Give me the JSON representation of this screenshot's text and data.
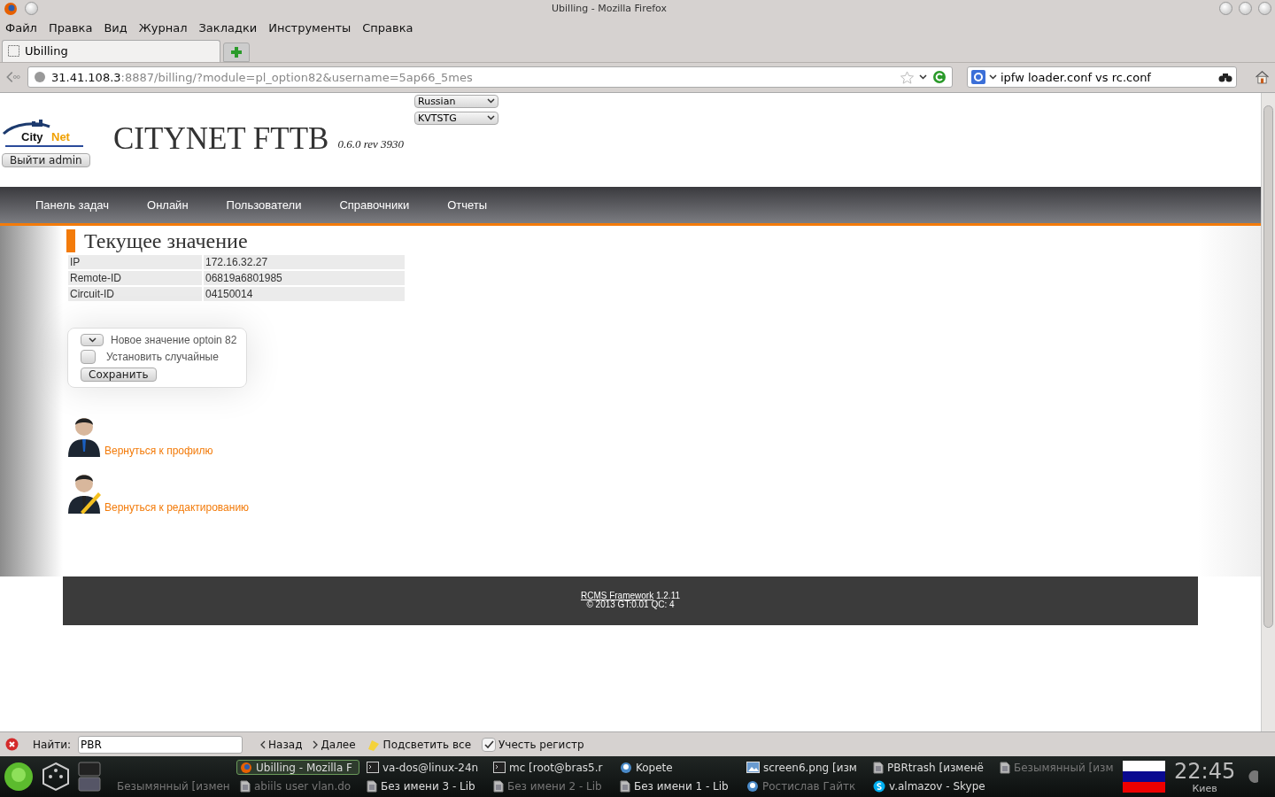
{
  "window": {
    "title": "Ubilling - Mozilla Firefox"
  },
  "menu": [
    "Файл",
    "Правка",
    "Вид",
    "Журнал",
    "Закладки",
    "Инструменты",
    "Справка"
  ],
  "tabs": [
    {
      "label": "Ubilling",
      "selected": true
    }
  ],
  "address": {
    "host": "31.41.108.3",
    "rest": ":8887/billing/?module=pl_option82&username=5ap66_5mes"
  },
  "search": {
    "value": "ipfw loader.conf vs rc.conf"
  },
  "logo": {
    "word_1": "City",
    "word_2": "Net"
  },
  "header": {
    "language": "Russian",
    "server": "KVTSTG",
    "logout": "Выйти admin",
    "title": "CITYNET FTTB",
    "version": "0.6.0 rev 3930"
  },
  "nav": [
    "Панель задач",
    "Онлайн",
    "Пользователи",
    "Справочники",
    "Отчеты"
  ],
  "section": {
    "title": "Текущее значение",
    "rows": [
      {
        "name": "IP",
        "value": "172.16.32.27"
      },
      {
        "name": "Remote-ID",
        "value": "06819a6801985"
      },
      {
        "name": "Circuit-ID",
        "value": "04150014"
      }
    ]
  },
  "form": {
    "select_label": "Новое значение optoin 82",
    "random_label": "Установить случайные",
    "random_checked": false,
    "save": "Сохранить"
  },
  "links": [
    {
      "kind": "profile",
      "label": "Вернуться к профилю"
    },
    {
      "kind": "edit",
      "label": "Вернуться к редактированию"
    }
  ],
  "footer": {
    "link": "RCMS Framework",
    "version": "1.2.11",
    "stats": "© 2013 GT:0.01 QC: 4"
  },
  "find_bar": {
    "label": "Найти:",
    "value": "PBR",
    "prev": "Назад",
    "next": "Далее",
    "highlight": "Подсветить все",
    "match_case": "Учесть регистр",
    "match_case_checked": true
  },
  "taskbar": {
    "columns": [
      {
        "bottom": {
          "label": "Безымянный [измен",
          "kind": "doc",
          "minimized": true
        }
      },
      {
        "top": {
          "label": "Ubilling - Mozilla F",
          "kind": "browser",
          "minimized": false,
          "selected": true
        },
        "bottom": {
          "label": "abiils user vlan.do",
          "kind": "doc",
          "minimized": true
        }
      },
      {
        "top": {
          "label": "va-dos@linux-24n",
          "kind": "terminal",
          "minimized": false
        },
        "bottom": {
          "label": "Без имени 3 - Lib",
          "kind": "doc",
          "minimized": false
        }
      },
      {
        "top": {
          "label": "mc [root@bras5.r",
          "kind": "terminal",
          "minimized": false
        },
        "bottom": {
          "label": "Без имени 2 - Lib",
          "kind": "doc",
          "minimized": true
        }
      },
      {
        "top": {
          "label": "Kopete",
          "kind": "chat",
          "minimized": false
        },
        "bottom": {
          "label": "Без имени 1 - Lib",
          "kind": "doc",
          "minimized": false
        }
      },
      {
        "top": {
          "label": "screen6.png [изм",
          "kind": "image",
          "minimized": false
        },
        "bottom": {
          "label": "Ростислав Гайтк",
          "kind": "chat",
          "minimized": true
        }
      },
      {
        "top": {
          "label": "PBRtrash [изменё",
          "kind": "doc",
          "minimized": false
        },
        "bottom": {
          "label": "v.almazov - Skype",
          "kind": "skype",
          "minimized": false
        }
      },
      {
        "top": {
          "label": "Безымянный [изм",
          "kind": "doc",
          "minimized": true
        }
      }
    ],
    "time": "22:45",
    "city": "Киев"
  }
}
